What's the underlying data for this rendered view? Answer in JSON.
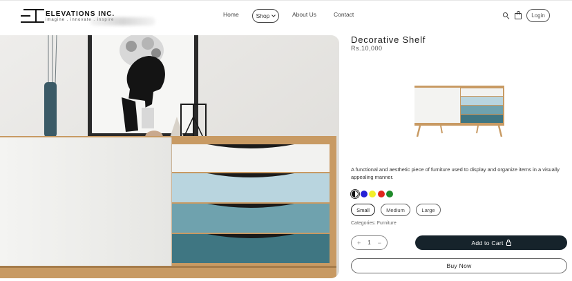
{
  "brand": {
    "name": "ELEVATIONS INC.",
    "tagline": "imagine . innovate . inspire"
  },
  "nav": {
    "home": "Home",
    "shop": "Shop",
    "about": "About Us",
    "contact": "Contact"
  },
  "header_actions": {
    "search_icon": "search-icon",
    "cart_icon": "shopping-bag-icon",
    "login_label": "Login"
  },
  "product": {
    "title": "Decorative Shelf",
    "price": "Rs.10,000",
    "description": "A functional and aesthetic piece of furniture used to display and organize items in a visually appealing manner.",
    "colors": [
      {
        "name": "black-white",
        "hex": "#111111",
        "selected": true
      },
      {
        "name": "blue",
        "hex": "#2622d6",
        "selected": false
      },
      {
        "name": "yellow",
        "hex": "#f2ef2a",
        "selected": false
      },
      {
        "name": "red",
        "hex": "#e0261d",
        "selected": false
      },
      {
        "name": "green",
        "hex": "#1f8a2a",
        "selected": false
      }
    ],
    "sizes": [
      "Small",
      "Medium",
      "Large"
    ],
    "selected_size": "Small",
    "categories_label": "Categories:",
    "categories_value": "Furniture",
    "quantity": "1",
    "qty_plus": "+",
    "qty_minus": "−",
    "add_to_cart_label": "Add to Cart",
    "buy_now_label": "Buy Now"
  },
  "colors": {
    "primary_dark": "#16232b",
    "drawer_white": "#f2f2f0",
    "drawer_light_blue": "#b9d5df",
    "drawer_mid_blue": "#6fa2ae",
    "drawer_teal": "#3f7682",
    "wood": "#c89a63"
  }
}
